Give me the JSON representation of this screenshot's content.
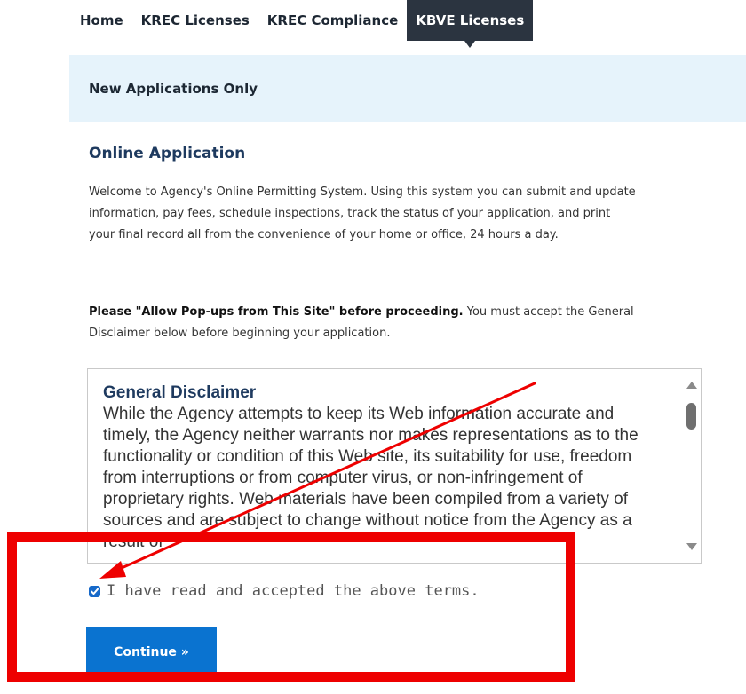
{
  "nav": {
    "items": [
      {
        "label": "Home"
      },
      {
        "label": "KREC Licenses"
      },
      {
        "label": "KREC Compliance"
      },
      {
        "label": "KBVE Licenses"
      }
    ],
    "active_index": 3
  },
  "notice": {
    "text": "New Applications Only"
  },
  "main": {
    "title": "Online Application",
    "welcome": "Welcome to Agency's Online Permitting System. Using this system you can submit and update information, pay fees, schedule inspections, track the status of your application, and print your final record all from the convenience of your home or office, 24 hours a day.",
    "popups_bold": "Please \"Allow Pop-ups from This Site\" before proceeding.",
    "popups_rest": " You must accept the General Disclaimer below before beginning your application."
  },
  "disclaimer": {
    "title": "General Disclaimer",
    "body": "While the Agency attempts to keep its Web information accurate and timely, the Agency neither warrants nor makes representations as to the functionality or condition of this Web site, its suitability for use, freedom from interruptions or from computer virus, or non-infringement of proprietary rights. Web materials have been compiled from a variety of sources and are subject to change without notice from the Agency as a result of"
  },
  "accept": {
    "label": "I have read and accepted the above terms.",
    "checked": true
  },
  "continue_button": {
    "label": "Continue »"
  },
  "colors": {
    "nav_active_bg": "#2b3440",
    "notice_bg": "#e6f3fb",
    "button_bg": "#0a73d0",
    "checkbox": "#1769c9",
    "annotation_red": "#ee0000"
  }
}
